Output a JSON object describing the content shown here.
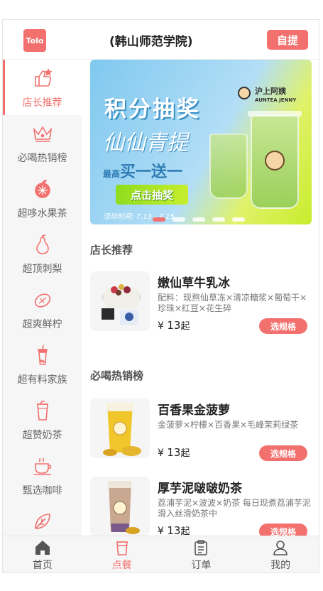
{
  "header": {
    "logo_text": "Tolo",
    "store_name": "(韩山师范学院)",
    "pickup_label": "自提"
  },
  "sidebar": {
    "items": [
      {
        "label": "店长推荐",
        "icon": "thumbs-up-icon",
        "active": true
      },
      {
        "label": "必喝热销榜",
        "icon": "crown-icon",
        "active": false
      },
      {
        "label": "超哆水果茶",
        "icon": "orange-icon",
        "active": false
      },
      {
        "label": "超顶刺梨",
        "icon": "pear-icon",
        "active": false
      },
      {
        "label": "超爽鲜柠",
        "icon": "lemon-icon",
        "active": false
      },
      {
        "label": "超有料家族",
        "icon": "bubble-tea-icon",
        "active": false
      },
      {
        "label": "超赞奶茶",
        "icon": "milk-tea-cup-icon",
        "active": false
      },
      {
        "label": "甄选咖啡",
        "icon": "coffee-cup-icon",
        "active": false
      },
      {
        "label": "",
        "icon": "leaf-icon",
        "active": false
      }
    ]
  },
  "banner": {
    "title": "积分抽奖",
    "script_text": "仙仙青提",
    "promo_prefix": "最高",
    "promo_main": "买一送一",
    "button_label": "点击抽奖",
    "date_text": "活动时间: 7.13 - 7.15",
    "brand_cn": "沪上阿姨",
    "brand_en": "AUNTEA JENNY",
    "dot_count": 5,
    "active_dot": 0
  },
  "sections": [
    {
      "title": "店长推荐",
      "products": [
        {
          "name": "嫩仙草牛乳冰",
          "desc": "配料：现熬仙草冻×清凉糖浆×葡萄干×珍珠×红豆×花生碎",
          "price_symbol": "¥",
          "price": "13",
          "price_suffix": "起",
          "button": "选规格"
        }
      ]
    },
    {
      "title": "必喝热销榜",
      "products": [
        {
          "name": "百香果金菠萝",
          "desc": "金菠萝×柠檬×百香果×毛峰茉莉绿茶",
          "price_symbol": "¥",
          "price": "13",
          "price_suffix": "起",
          "button": "选规格"
        },
        {
          "name": "厚芋泥啵啵奶茶",
          "desc": "荔浦芋泥×波波×奶茶 每日现煮荔浦芋泥滑入丝滑奶茶中",
          "price_symbol": "¥",
          "price": "13",
          "price_suffix": "起",
          "button": "选规格"
        }
      ]
    }
  ],
  "tabbar": {
    "items": [
      {
        "label": "首页",
        "icon": "home-icon",
        "active": false
      },
      {
        "label": "点餐",
        "icon": "order-cup-icon",
        "active": true
      },
      {
        "label": "订单",
        "icon": "clipboard-icon",
        "active": false
      },
      {
        "label": "我的",
        "icon": "user-icon",
        "active": false
      }
    ]
  },
  "colors": {
    "accent": "#f2716e",
    "sidebar_bg": "#f6f6f6",
    "text_dark": "#222222",
    "text_muted": "#777777"
  }
}
